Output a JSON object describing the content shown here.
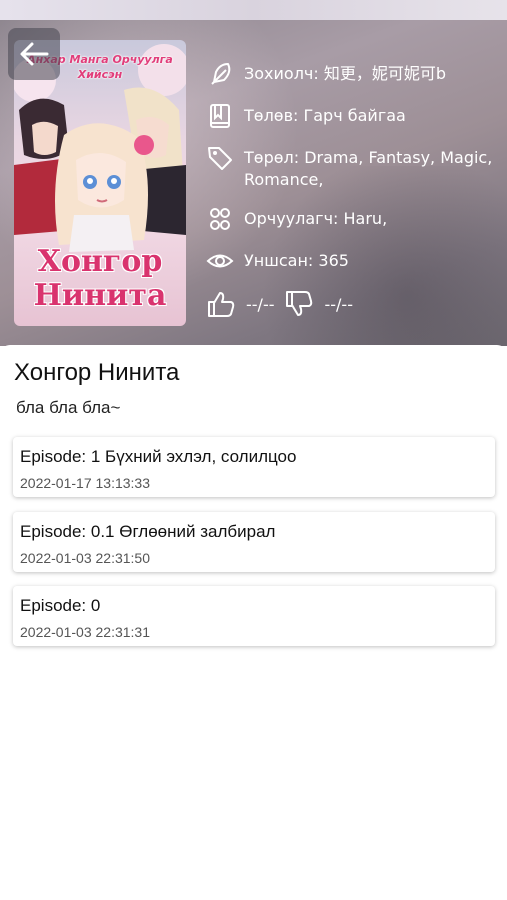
{
  "cover": {
    "subtitle": "Анхар Манга Орчуулга Хийсэн",
    "title": "Хонгор Нинита"
  },
  "info": {
    "author": "Зохиолч: 知更，妮可妮可b",
    "status": "Төлөв: Гарч байгаа",
    "genre": "Төрөл: Drama, Fantasy, Magic, Romance,",
    "translator": "Орчуулагч: Haru,",
    "views": "Уншсан: 365",
    "likes": "--/--",
    "dislikes": "--/--"
  },
  "main": {
    "title": "Хонгор Нинита",
    "description": "бла бла бла~"
  },
  "episodes": [
    {
      "title": "Episode: 1 Бүхний эхлэл, солилцоо",
      "date": "2022-01-17 13:13:33"
    },
    {
      "title": "Episode: 0.1 Өглөөний залбирал",
      "date": "2022-01-03 22:31:50"
    },
    {
      "title": "Episode: 0",
      "date": "2022-01-03 22:31:31"
    }
  ],
  "icons": {
    "back": "arrow-left-icon",
    "author": "feather-icon",
    "status": "book-icon",
    "genre": "tag-icon",
    "translator": "group-icon",
    "views": "eye-icon",
    "like": "thumbs-up-icon",
    "dislike": "thumbs-down-icon"
  },
  "colors": {
    "accent": "#d9336e",
    "header_text": "#ffffff"
  }
}
